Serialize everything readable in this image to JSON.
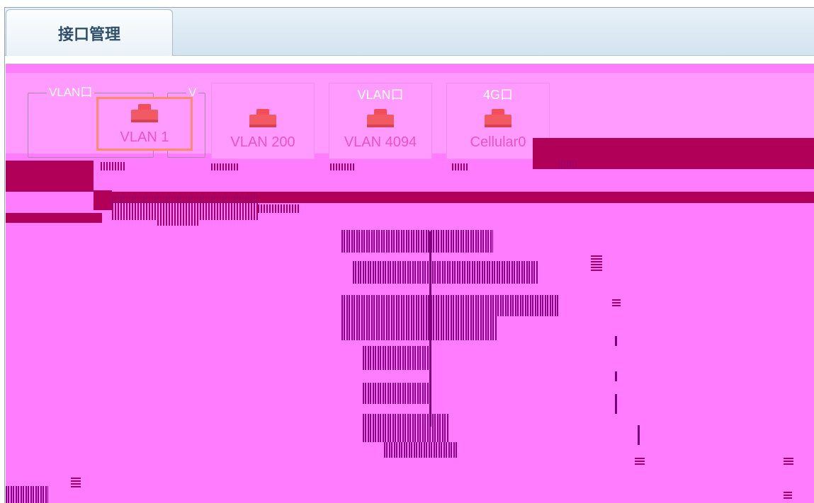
{
  "tab": {
    "label": "接口管理"
  },
  "groups": [
    {
      "legend": "VLAN口"
    },
    {
      "legend": "V"
    }
  ],
  "cards": [
    {
      "type": "",
      "name": "VLAN 1",
      "selected": true
    },
    {
      "type": "",
      "name": "VLAN 200",
      "selected": false
    },
    {
      "type": "VLAN口",
      "name": "VLAN 4094",
      "selected": false
    },
    {
      "type": "4G口",
      "name": "Cellular0",
      "selected": false
    }
  ],
  "colors": {
    "tab_bar": "#dbe8f2",
    "content_bg": "#ff7cff",
    "card_bg": "#ff9aff",
    "card_name": "#ea54c1",
    "port_icon": "#f15a63",
    "selected_border": "#ff8a66",
    "glitch_dark": "#b00058"
  },
  "icons": {
    "port": "ethernet-port-icon"
  }
}
